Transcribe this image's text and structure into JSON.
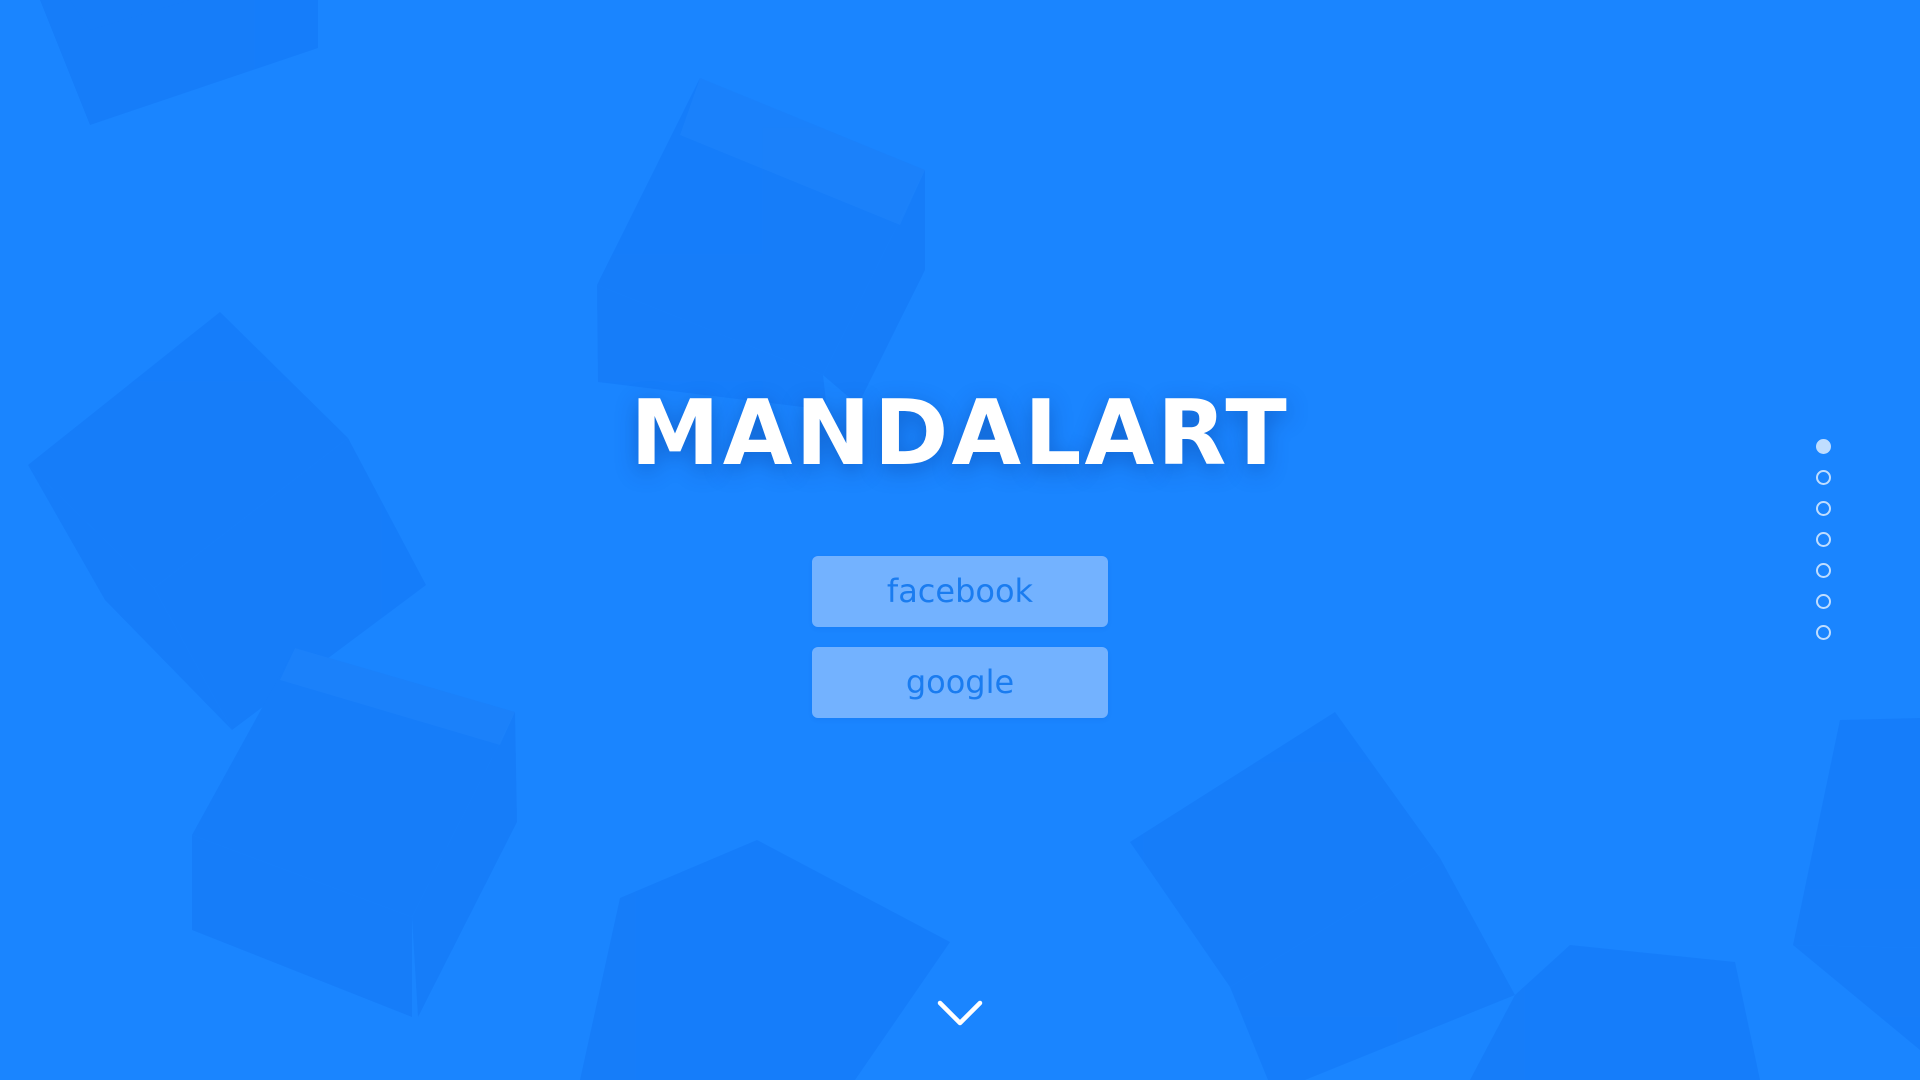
{
  "hero": {
    "title": "MANDALART"
  },
  "login": {
    "facebook_label": "facebook",
    "google_label": "google"
  },
  "pagination": {
    "total": 7,
    "active_index": 0
  },
  "scroll": {
    "icon": "chevron-down-icon"
  },
  "colors": {
    "background": "#1a85ff",
    "button_background": "#73b2ff",
    "button_text": "#1a7cf0",
    "title": "#ffffff"
  }
}
